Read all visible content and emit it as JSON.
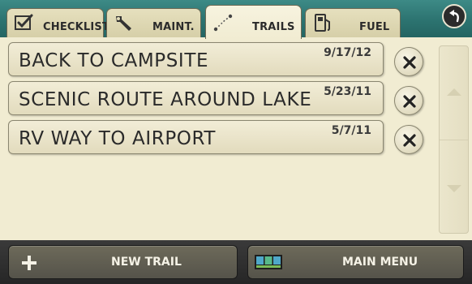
{
  "tabs": {
    "checklist": {
      "label": "CHECKLIST",
      "icon": "checklist-icon"
    },
    "maint": {
      "label": "MAINT.",
      "icon": "wrench-icon"
    },
    "trails": {
      "label": "TRAILS",
      "icon": "trail-path-icon",
      "active": true
    },
    "fuel": {
      "label": "FUEL",
      "icon": "fuel-pump-icon"
    }
  },
  "back_icon": "back-arrow-icon",
  "trails": [
    {
      "name": "BACK TO CAMPSITE",
      "date": "9/17/12"
    },
    {
      "name": "SCENIC ROUTE AROUND LAKE",
      "date": "5/23/11"
    },
    {
      "name": "RV WAY TO AIRPORT",
      "date": "5/7/11"
    }
  ],
  "bottom": {
    "new_trail_label": "NEW TRAIL",
    "main_menu_label": "MAIN MENU"
  },
  "colors": {
    "header_teal": "#2c7370",
    "background_beige": "#f1ecd2",
    "bottom_bar": "#2b2b2b"
  }
}
